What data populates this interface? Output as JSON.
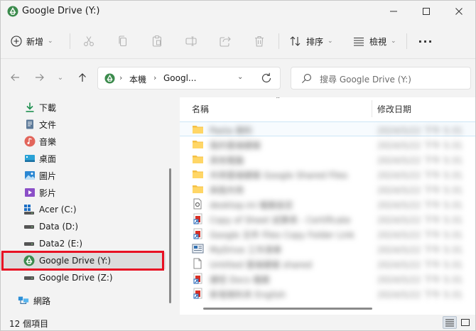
{
  "window": {
    "title": "Google Drive (Y:)"
  },
  "toolbar": {
    "new_label": "新增",
    "sort_label": "排序",
    "view_label": "檢視",
    "more_label": "···"
  },
  "address": {
    "segment1": "本機",
    "segment2": "Googl...",
    "separator": "›"
  },
  "search": {
    "placeholder": "搜尋 Google Drive (Y:)"
  },
  "sidebar": {
    "items": [
      {
        "label": "下載",
        "icon": "download-icon"
      },
      {
        "label": "文件",
        "icon": "document-icon"
      },
      {
        "label": "音樂",
        "icon": "music-icon"
      },
      {
        "label": "桌面",
        "icon": "desktop-icon"
      },
      {
        "label": "圖片",
        "icon": "pictures-icon"
      },
      {
        "label": "影片",
        "icon": "videos-icon"
      },
      {
        "label": "Acer (C:)",
        "icon": "windows-drive-icon"
      },
      {
        "label": "Data (D:)",
        "icon": "drive-icon"
      },
      {
        "label": "Data2 (E:)",
        "icon": "drive-icon"
      },
      {
        "label": "Google Drive (Y:)",
        "icon": "google-drive-icon",
        "selected": true
      },
      {
        "label": "Google Drive (Z:)",
        "icon": "drive-icon"
      },
      {
        "label": "網路",
        "icon": "network-icon"
      }
    ]
  },
  "columns": {
    "name": "名稱",
    "date": "修改日期"
  },
  "files": [
    {
      "name": "Pasta 資料",
      "date": "2024/5/22 下午 5:31",
      "icon": "folder-icon"
    },
    {
      "name": "我的雲端硬碟",
      "date": "2024/5/22 下午 5:31",
      "icon": "folder-icon"
    },
    {
      "name": "其他電腦",
      "date": "2024/5/22 下午 5:31",
      "icon": "folder-icon"
    },
    {
      "name": "共用雲端硬碟 Google Shared Files",
      "date": "2024/5/22 下午 5:31",
      "icon": "folder-icon"
    },
    {
      "name": "與我共用",
      "date": "2024/5/22 下午 5:31",
      "icon": "folder-icon"
    },
    {
      "name": "desktop.ini 檔案設定",
      "date": "2024/5/22 下午 5:31",
      "icon": "settings-file-icon"
    },
    {
      "name": "Copy of Sheet 試算表 - Certificate",
      "date": "2024/5/22 下午 5:31",
      "icon": "shortcut-icon"
    },
    {
      "name": "Google 文件 Files Copy Folder Link",
      "date": "2024/5/22 下午 5:31",
      "icon": "shortcut-icon"
    },
    {
      "name": "MyDrive 工作清單",
      "date": "2024/5/22 下午 5:31",
      "icon": "image-file-icon"
    },
    {
      "name": "Untitled 雲端硬碟 shared",
      "date": "2024/5/22 下午 5:31",
      "icon": "blank-file-icon"
    },
    {
      "name": "捷徑 Docs 檔案",
      "date": "2024/5/22 下午 5:31",
      "icon": "shortcut-icon"
    },
    {
      "name": "新增資料夾 English",
      "date": "2024/5/22 下午 5:31",
      "icon": "shortcut-icon"
    }
  ],
  "status": {
    "item_count": "12 個項目"
  },
  "colors": {
    "accent": "#0067c0",
    "selection_outline": "#e81123",
    "folder": "#f4c045",
    "drive_green": "#1fa463",
    "drive_blue": "#4285f4",
    "drive_yellow": "#ffcd40"
  }
}
